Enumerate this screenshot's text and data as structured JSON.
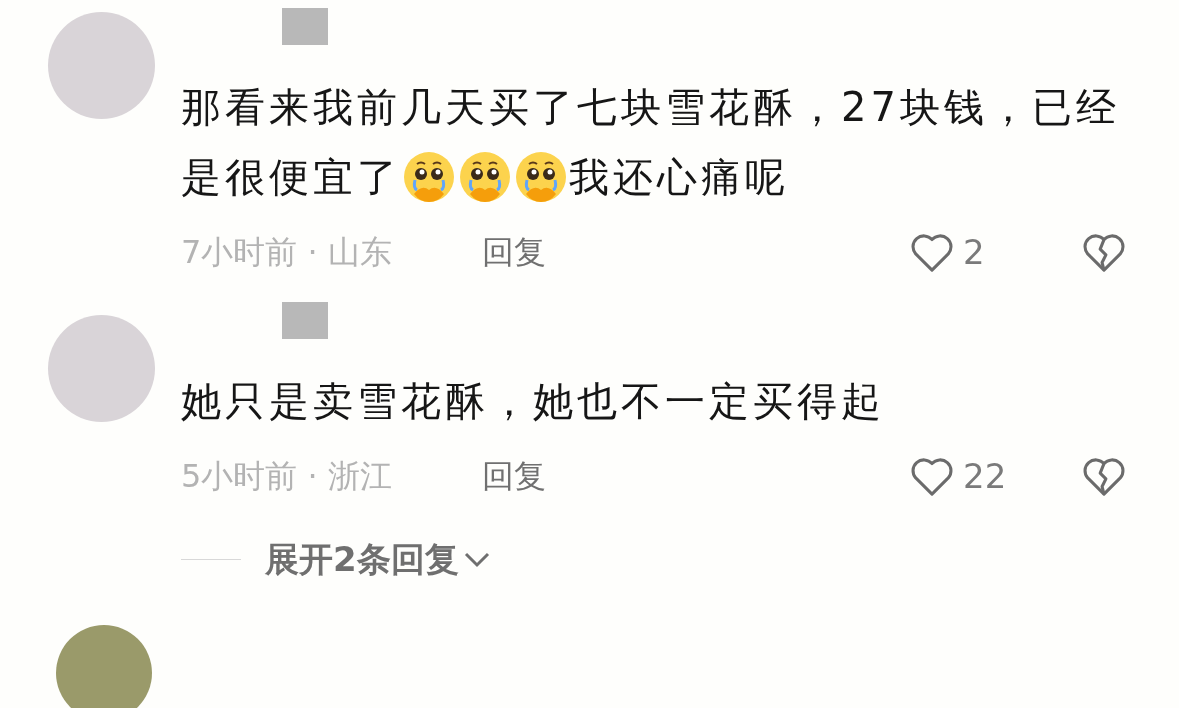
{
  "comments": [
    {
      "lines": [
        [
          {
            "kind": "text",
            "text": "那看来我前几天买了七块雪花酥，27块钱，已经"
          }
        ],
        [
          {
            "kind": "text",
            "text": "是很便宜了"
          },
          {
            "kind": "emoji"
          },
          {
            "kind": "emoji"
          },
          {
            "kind": "emoji"
          },
          {
            "kind": "text",
            "text": "我还心痛呢"
          }
        ]
      ],
      "time": "7小时前 · 山东",
      "reply": "回复",
      "likes": "2"
    },
    {
      "lines": [
        [
          {
            "kind": "text",
            "text": "她只是卖雪花酥，她也不一定买得起"
          }
        ]
      ],
      "time": "5小时前 · 浙江",
      "reply": "回复",
      "likes": "22"
    }
  ],
  "expand": {
    "label": "展开2条回复"
  }
}
